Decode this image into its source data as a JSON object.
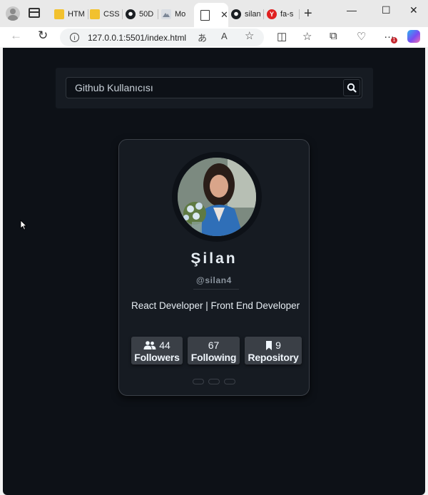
{
  "browser": {
    "tabs": [
      {
        "label": "HTM",
        "favicon": "folder-icon"
      },
      {
        "label": "CSS",
        "favicon": "folder-icon"
      },
      {
        "label": "50D",
        "favicon": "github-icon"
      },
      {
        "label": "Mo",
        "favicon": "mountain-icon"
      },
      {
        "label": "",
        "favicon": "page-icon",
        "active": true
      },
      {
        "label": "silan",
        "favicon": "github-icon"
      },
      {
        "label": "fa-s",
        "favicon": "yandex-icon"
      }
    ],
    "address_url": "127.0.0.1:5501/index.html",
    "notification_count": "1"
  },
  "search": {
    "placeholder": "Github Kullanıcısı"
  },
  "profile": {
    "name": "Şilan",
    "login": "@silan4",
    "bio": "React Developer | Front End Developer"
  },
  "stats": [
    {
      "value": "44",
      "label": "Followers",
      "icon": "users-icon"
    },
    {
      "value": "67",
      "label": "Following",
      "icon": ""
    },
    {
      "value": "9",
      "label": "Repository",
      "icon": "bookmark-icon"
    }
  ],
  "colors": {
    "page_bg": "#0d1117",
    "card_bg": "#161b22",
    "stat_bg": "#3a3f46",
    "text": "#e6edf3"
  }
}
